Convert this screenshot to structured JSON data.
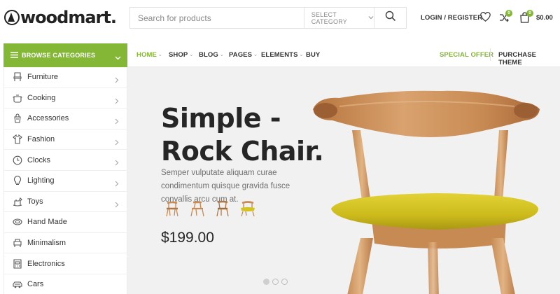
{
  "header": {
    "logo_text": "woodmart.",
    "search": {
      "placeholder": "Search for products",
      "category_label": "SELECT CATEGORY"
    },
    "login_label": "LOGIN / REGISTER",
    "compare_count": "0",
    "cart_count": "0",
    "cart_total": "$0.00"
  },
  "sidebar": {
    "title": "BROWSE CATEGORIES",
    "items": [
      {
        "label": "Furniture",
        "icon": "chair-icon",
        "has_submenu": true
      },
      {
        "label": "Cooking",
        "icon": "cooking-pot-icon",
        "has_submenu": true
      },
      {
        "label": "Accessories",
        "icon": "accessories-icon",
        "has_submenu": true
      },
      {
        "label": "Fashion",
        "icon": "shirt-icon",
        "has_submenu": true
      },
      {
        "label": "Clocks",
        "icon": "clock-icon",
        "has_submenu": true
      },
      {
        "label": "Lighting",
        "icon": "bulb-icon",
        "has_submenu": true
      },
      {
        "label": "Toys",
        "icon": "toy-horse-icon",
        "has_submenu": true
      },
      {
        "label": "Hand Made",
        "icon": "handmade-icon",
        "has_submenu": false
      },
      {
        "label": "Minimalism",
        "icon": "minimalism-icon",
        "has_submenu": false
      },
      {
        "label": "Electronics",
        "icon": "electronics-icon",
        "has_submenu": false
      },
      {
        "label": "Cars",
        "icon": "car-icon",
        "has_submenu": false
      }
    ]
  },
  "nav": {
    "items": [
      {
        "label": "HOME",
        "active": true,
        "dropdown": true
      },
      {
        "label": "SHOP",
        "active": false,
        "dropdown": true
      },
      {
        "label": "BLOG",
        "active": false,
        "dropdown": true
      },
      {
        "label": "PAGES",
        "active": false,
        "dropdown": true
      },
      {
        "label": "ELEMENTS",
        "active": false,
        "dropdown": true
      },
      {
        "label": "BUY",
        "active": false,
        "dropdown": false
      }
    ],
    "special_offer": "SPECIAL OFFER",
    "purchase_theme": "PURCHASE THEME"
  },
  "hero": {
    "title_line1": "Simple -",
    "title_line2": "Rock Chair.",
    "description": "Semper vulputate aliquam curae condimentum quisque gravida fusce convallis arcu cum at.",
    "price": "$199.00",
    "thumbnails": [
      "chair-thumb-1",
      "chair-thumb-2",
      "chair-thumb-3",
      "chair-thumb-4"
    ],
    "slides": 3,
    "active_slide": 1
  },
  "colors": {
    "accent": "#83b735",
    "text_dark": "#262626",
    "hero_bg": "#f1f1f1",
    "chair_wood": "#c98b55",
    "chair_seat": "#d4c21f"
  }
}
